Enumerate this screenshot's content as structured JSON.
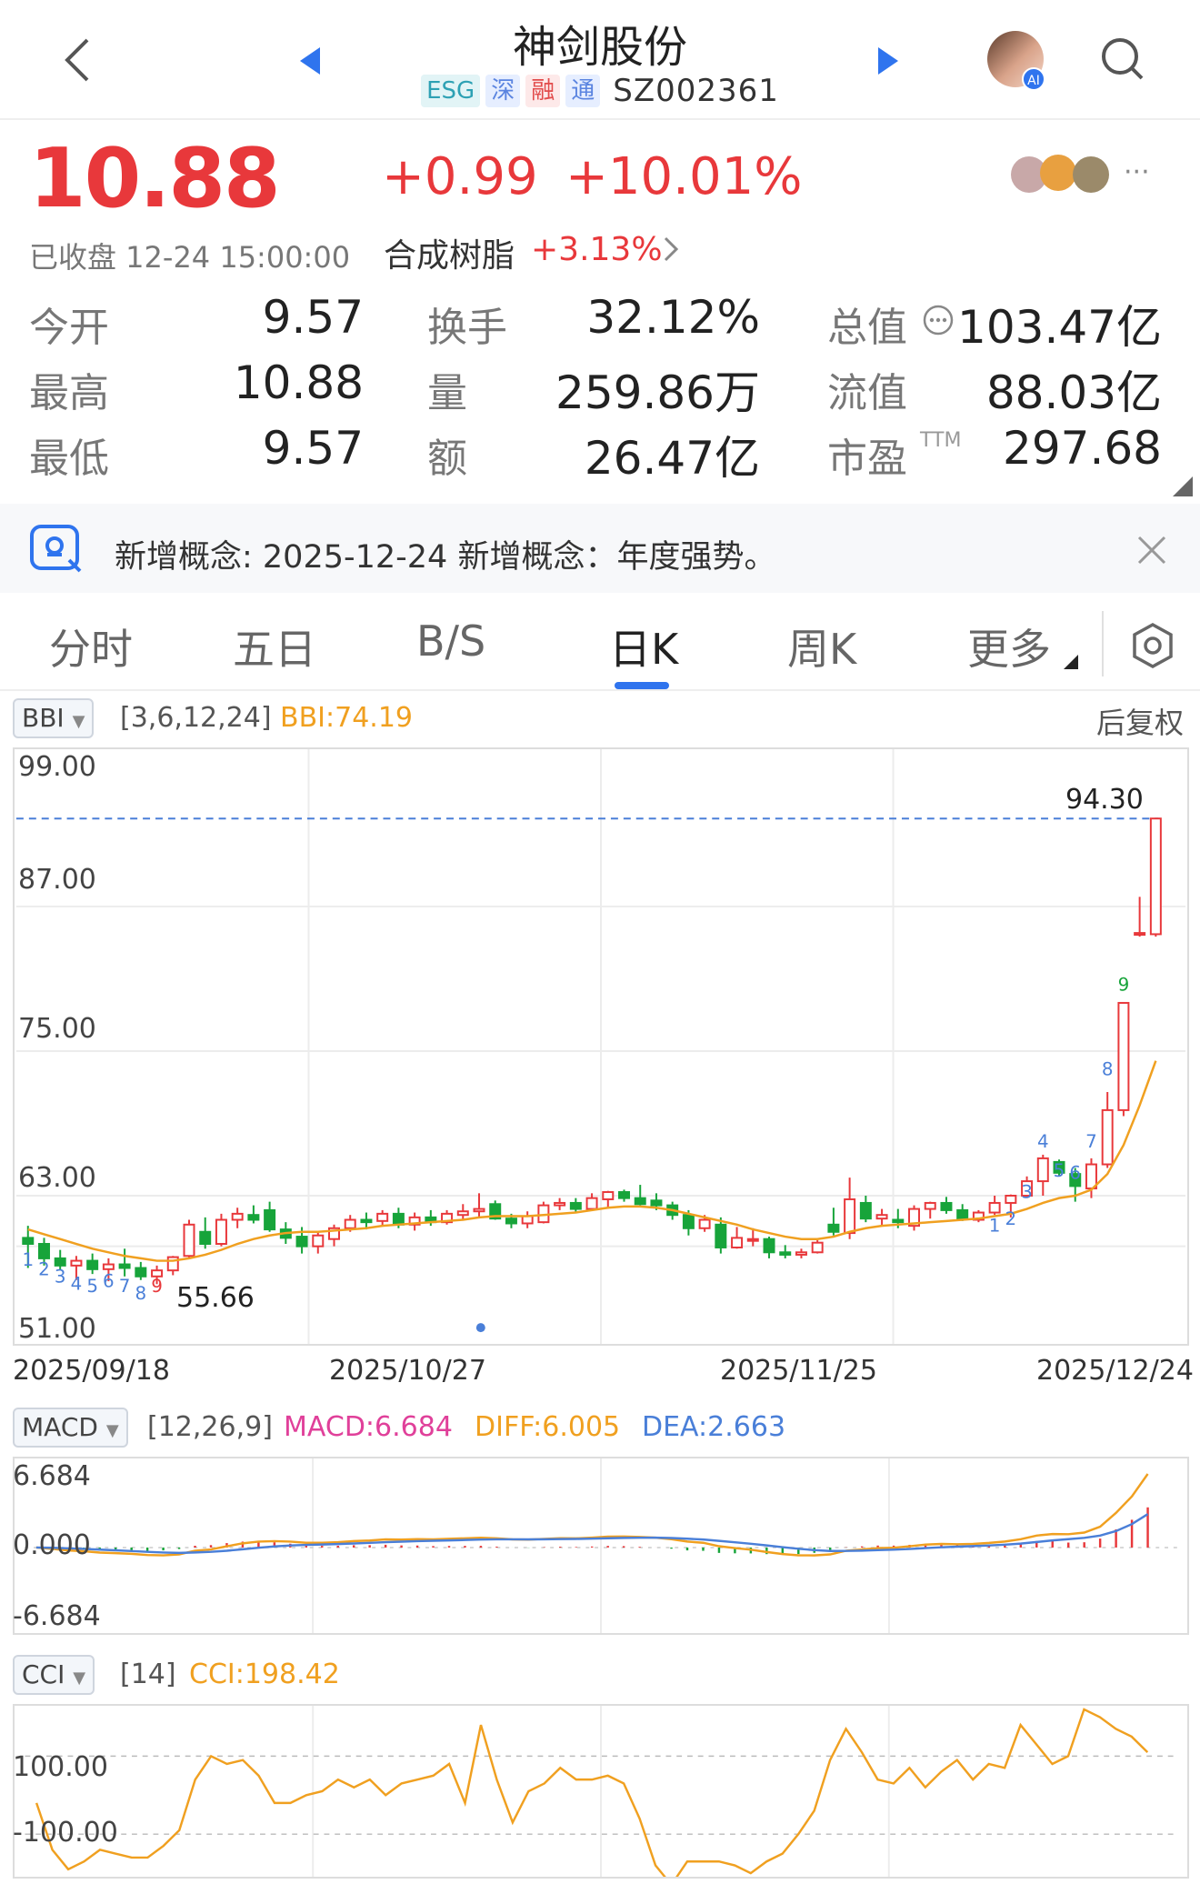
{
  "header": {
    "title": "神剑股份",
    "tags": [
      "ESG",
      "深",
      "融",
      "通"
    ],
    "code": "SZ002361"
  },
  "quote": {
    "price": "10.88",
    "change": "+0.99",
    "change_pct": "+10.01%",
    "status": "已收盘 12-24 15:00:00",
    "sector_name": "合成树脂",
    "sector_pct": "+3.13%",
    "more_glyph": "···"
  },
  "stats": {
    "open_label": "今开",
    "open": "9.57",
    "high_label": "最高",
    "high": "10.88",
    "low_label": "最低",
    "low": "9.57",
    "turnover_label": "换手",
    "turnover": "32.12%",
    "volume_label": "量",
    "volume": "259.86万",
    "amount_label": "额",
    "amount": "26.47亿",
    "mktcap_label": "总值",
    "mktcap": "103.47亿",
    "float_label": "流值",
    "float": "88.03亿",
    "pe_label": "市盈",
    "pe_sup": "TTM",
    "pe": "297.68"
  },
  "notice": {
    "text": "新增概念: 2025-12-24 新增概念：年度强势。"
  },
  "tabs": [
    {
      "label": "分时"
    },
    {
      "label": "五日"
    },
    {
      "label": "B/S"
    },
    {
      "label": "日K",
      "active": true
    },
    {
      "label": "周K"
    },
    {
      "label": "更多"
    }
  ],
  "kline": {
    "indicator": "BBI",
    "params": "[3,6,12,24]",
    "bbi_value": "BBI:74.19",
    "adjust": "后复权",
    "y_labels": [
      "99.00",
      "87.00",
      "75.00",
      "63.00",
      "51.00"
    ],
    "max_label": "94.30",
    "min_label": "55.66",
    "dates": [
      "2025/09/18",
      "2025/10/27",
      "2025/11/25",
      "2025/12/24"
    ],
    "seq_low": [
      "1",
      "2",
      "3",
      "4",
      "5",
      "6",
      "7",
      "8",
      "9"
    ],
    "seq_high": [
      "1",
      "2",
      "3",
      "4",
      "5",
      "6",
      "7",
      "8",
      "9"
    ]
  },
  "macd": {
    "indicator": "MACD",
    "params": "[12,26,9]",
    "macd": "MACD:6.684",
    "diff": "DIFF:6.005",
    "dea": "DEA:2.663",
    "y_labels": [
      "6.684",
      "0.000",
      "-6.684"
    ]
  },
  "cci": {
    "indicator": "CCI",
    "params": "[14]",
    "cci": "CCI:198.42",
    "y_labels": [
      "100.00",
      "-100.00"
    ]
  },
  "colors": {
    "up": "#e8383b",
    "down": "#17a43a",
    "bbi": "#f0a020",
    "dea": "#4a7fd8",
    "macd": "#e0409a",
    "accent": "#2f74ee"
  },
  "chart_data": [
    {
      "type": "candlestick",
      "indicator": "BBI",
      "ylim": [
        51,
        99
      ],
      "x_ticks": [
        "2025/09/18",
        "2025/10/27",
        "2025/11/25",
        "2025/12/24"
      ],
      "candles": [
        [
          59.5,
          60.5,
          57.0,
          59.0
        ],
        [
          59.0,
          59.5,
          57.2,
          57.8
        ],
        [
          57.8,
          58.5,
          56.8,
          57.2
        ],
        [
          57.2,
          58.0,
          56.0,
          57.6
        ],
        [
          57.6,
          58.2,
          56.5,
          56.9
        ],
        [
          56.9,
          57.8,
          55.9,
          57.3
        ],
        [
          57.3,
          58.6,
          56.3,
          57.0
        ],
        [
          57.0,
          57.5,
          56.0,
          56.3
        ],
        [
          56.3,
          57.2,
          55.66,
          56.8
        ],
        [
          56.8,
          58.0,
          56.4,
          57.9
        ],
        [
          58.0,
          61.0,
          57.8,
          60.6
        ],
        [
          60.0,
          61.2,
          58.6,
          59.0
        ],
        [
          59.0,
          61.5,
          58.8,
          61.0
        ],
        [
          61.0,
          62.0,
          60.3,
          61.5
        ],
        [
          61.4,
          62.2,
          60.7,
          61.0
        ],
        [
          61.8,
          62.5,
          60.0,
          60.2
        ],
        [
          60.2,
          60.8,
          59.0,
          59.5
        ],
        [
          59.6,
          60.4,
          58.2,
          58.8
        ],
        [
          58.8,
          60.0,
          58.2,
          59.7
        ],
        [
          59.4,
          60.6,
          58.8,
          60.3
        ],
        [
          60.3,
          61.4,
          60.0,
          61.0
        ],
        [
          61.0,
          61.6,
          60.2,
          60.8
        ],
        [
          60.9,
          61.8,
          60.5,
          61.5
        ],
        [
          61.5,
          62.0,
          60.3,
          60.6
        ],
        [
          60.6,
          61.6,
          60.1,
          61.2
        ],
        [
          61.2,
          61.8,
          60.5,
          60.8
        ],
        [
          60.8,
          61.8,
          60.6,
          61.5
        ],
        [
          61.4,
          62.3,
          61.0,
          61.7
        ],
        [
          61.7,
          63.2,
          61.2,
          61.9
        ],
        [
          62.3,
          62.6,
          61.0,
          61.1
        ],
        [
          61.1,
          61.5,
          60.3,
          60.7
        ],
        [
          60.7,
          61.7,
          60.3,
          61.3
        ],
        [
          60.8,
          62.5,
          60.7,
          62.2
        ],
        [
          62.2,
          62.8,
          61.8,
          62.4
        ],
        [
          62.4,
          62.8,
          61.6,
          61.9
        ],
        [
          61.9,
          63.2,
          61.8,
          62.8
        ],
        [
          62.7,
          63.4,
          62.0,
          63.3
        ],
        [
          63.3,
          63.5,
          62.5,
          62.8
        ],
        [
          62.8,
          63.9,
          62.2,
          62.3
        ],
        [
          62.6,
          63.2,
          61.8,
          62.2
        ],
        [
          62.2,
          62.5,
          61.0,
          61.4
        ],
        [
          61.4,
          61.8,
          59.7,
          60.3
        ],
        [
          60.3,
          61.4,
          60.0,
          61.0
        ],
        [
          60.6,
          61.2,
          58.2,
          58.7
        ],
        [
          58.7,
          60.4,
          58.6,
          59.5
        ],
        [
          59.3,
          60.3,
          58.8,
          59.4
        ],
        [
          59.4,
          59.6,
          57.8,
          58.3
        ],
        [
          58.3,
          58.9,
          57.8,
          58.1
        ],
        [
          58.1,
          58.6,
          57.8,
          58.3
        ],
        [
          58.3,
          59.3,
          58.2,
          59.1
        ],
        [
          60.6,
          62.0,
          59.7,
          60.0
        ],
        [
          59.9,
          64.5,
          59.4,
          62.7
        ],
        [
          62.4,
          63.0,
          60.8,
          61.1
        ],
        [
          61.1,
          61.9,
          60.5,
          61.4
        ],
        [
          61.0,
          61.9,
          60.3,
          60.8
        ],
        [
          60.5,
          62.2,
          60.1,
          61.9
        ],
        [
          61.9,
          62.5,
          61.1,
          62.4
        ],
        [
          62.4,
          62.9,
          61.5,
          61.8
        ],
        [
          61.8,
          62.3,
          60.9,
          61.1
        ],
        [
          61.0,
          61.8,
          60.8,
          61.6
        ],
        [
          61.6,
          63.0,
          61.4,
          62.4
        ],
        [
          62.4,
          63.1,
          61.2,
          63.0
        ],
        [
          63.0,
          64.6,
          62.8,
          64.2
        ],
        [
          64.2,
          66.4,
          63.0,
          66.1
        ],
        [
          65.8,
          66.0,
          64.6,
          64.9
        ],
        [
          64.8,
          65.3,
          62.5,
          63.8
        ],
        [
          63.6,
          66.1,
          62.8,
          65.6
        ],
        [
          65.6,
          71.6,
          65.3,
          70.1
        ],
        [
          70.1,
          79.0,
          69.6,
          79.0
        ],
        [
          84.7,
          87.8,
          84.5,
          84.8
        ],
        [
          84.7,
          94.3,
          84.5,
          94.3
        ]
      ],
      "bbi": [
        60.2,
        59.8,
        59.4,
        59.0,
        58.6,
        58.3,
        58.0,
        57.8,
        57.6,
        57.6,
        57.8,
        58.1,
        58.5,
        59.0,
        59.4,
        59.7,
        59.9,
        60.0,
        60.0,
        60.1,
        60.2,
        60.3,
        60.5,
        60.6,
        60.7,
        60.8,
        60.9,
        61.0,
        61.2,
        61.3,
        61.3,
        61.3,
        61.4,
        61.5,
        61.6,
        61.8,
        62.0,
        62.1,
        62.1,
        62.0,
        61.8,
        61.5,
        61.2,
        60.9,
        60.6,
        60.2,
        59.9,
        59.6,
        59.4,
        59.4,
        59.6,
        60.0,
        60.3,
        60.5,
        60.6,
        60.7,
        60.8,
        60.9,
        61.0,
        61.1,
        61.3,
        61.5,
        61.9,
        62.4,
        62.8,
        63.0,
        63.5,
        64.8,
        67.2,
        70.5,
        74.19
      ]
    },
    {
      "type": "bar+line",
      "indicator": "MACD",
      "ylim": [
        -6.684,
        6.684
      ],
      "macd_last": 6.684,
      "diff_last": 6.005,
      "dea_last": 2.663
    },
    {
      "type": "line",
      "indicator": "CCI",
      "ylim": [
        -200,
        220
      ],
      "values": [
        -20,
        -140,
        -190,
        -170,
        -140,
        -150,
        -160,
        -160,
        -130,
        -90,
        40,
        100,
        80,
        90,
        50,
        -20,
        -20,
        0,
        10,
        40,
        20,
        40,
        0,
        30,
        40,
        50,
        80,
        -20,
        180,
        40,
        -70,
        10,
        30,
        70,
        40,
        40,
        50,
        30,
        -60,
        -180,
        -230,
        -170,
        -170,
        -170,
        -180,
        -200,
        -170,
        -150,
        -100,
        -40,
        90,
        170,
        110,
        40,
        30,
        70,
        20,
        60,
        90,
        40,
        80,
        70,
        180,
        130,
        80,
        100,
        220,
        200,
        170,
        150,
        110
      ]
    }
  ]
}
